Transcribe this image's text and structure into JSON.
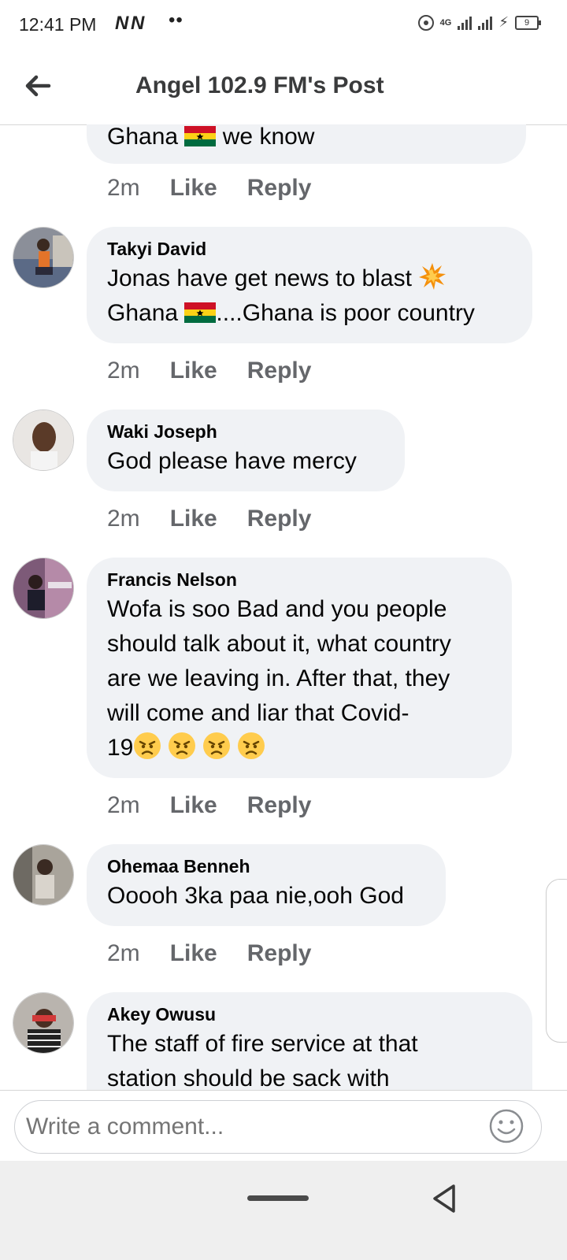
{
  "status_bar": {
    "time": "12:41 PM",
    "carrier_icons": "N N",
    "dots": "••",
    "network": "4G",
    "battery": "9"
  },
  "header": {
    "title": "Angel 102.9 FM's Post"
  },
  "comments": [
    {
      "author": "",
      "text_before_flag": "Ghana ",
      "text_after_flag": " we know",
      "time": "2m",
      "like": "Like",
      "reply": "Reply"
    },
    {
      "author": "Takyi David",
      "line1": "Jonas have get news to blast ",
      "line2_before_flag": "Ghana ",
      "line2_after_flag": "....Ghana is poor country",
      "time": "2m",
      "like": "Like",
      "reply": "Reply"
    },
    {
      "author": "Waki Joseph",
      "text": "God please have mercy",
      "time": "2m",
      "like": "Like",
      "reply": "Reply"
    },
    {
      "author": "Francis Nelson",
      "lines": [
        "Wofa is soo Bad and you people",
        "should talk about it, what country",
        "are we leaving in. After that, they",
        "will come and liar that Covid-"
      ],
      "last_line": "19",
      "time": "2m",
      "like": "Like",
      "reply": "Reply"
    },
    {
      "author": "Ohemaa Benneh",
      "text": "Ooooh 3ka paa nie,ooh God",
      "time": "2m",
      "like": "Like",
      "reply": "Reply"
    },
    {
      "author": "Akey Owusu",
      "lines": [
        "The staff of fire service at that",
        "station should be sack with"
      ]
    }
  ],
  "composer": {
    "placeholder": "Write a comment..."
  },
  "icons": {
    "back": "back-arrow-icon",
    "smiley": "smiley-icon",
    "flag": "ghana-flag-icon",
    "collision": "collision-emoji-icon",
    "angry": "angry-face-emoji-icon"
  },
  "colors": {
    "bubble": "#f0f2f5",
    "meta_text": "#65676b",
    "header_text": "#3a3b3c",
    "nav_bar": "#efefef"
  }
}
